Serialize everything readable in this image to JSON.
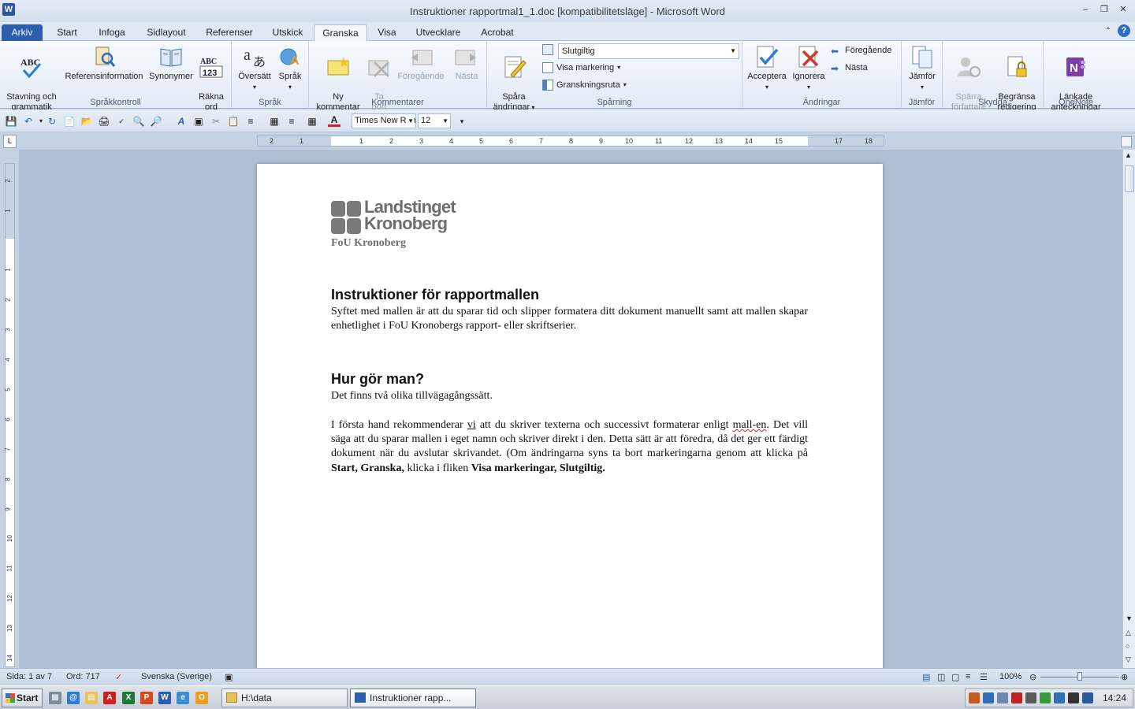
{
  "window": {
    "title": "Instruktioner rapportmal1_1.doc [kompatibilitetsläge]  -  Microsoft Word",
    "app_icon": "W"
  },
  "tabs": [
    {
      "label": "Arkiv"
    },
    {
      "label": "Start"
    },
    {
      "label": "Infoga"
    },
    {
      "label": "Sidlayout"
    },
    {
      "label": "Referenser"
    },
    {
      "label": "Utskick"
    },
    {
      "label": "Granska"
    },
    {
      "label": "Visa"
    },
    {
      "label": "Utvecklare"
    },
    {
      "label": "Acrobat"
    }
  ],
  "ribbon": {
    "sprakkontroll": {
      "label": "Språkkontroll",
      "stavning": "Stavning och\ngrammatik",
      "referens": "Referensinformation",
      "synonymer": "Synonymer",
      "rakna": "Räkna\nord"
    },
    "sprak": {
      "label": "Språk",
      "oversatt": "Översätt",
      "sprak_btn": "Språk"
    },
    "kommentarer": {
      "label": "Kommentarer",
      "ny": "Ny\nkommentar",
      "tabort": "Ta\nbort",
      "foregaende": "Föregående",
      "nasta": "Nästa"
    },
    "sparning": {
      "label": "Spårning",
      "spara": "Spåra\nändringar",
      "combo_value": "Slutgiltig",
      "visa_markering": "Visa markering",
      "granskningsruta": "Granskningsruta"
    },
    "andringar": {
      "label": "Ändringar",
      "acceptera": "Acceptera",
      "ignorera": "Ignorera",
      "foregaende": "Föregående",
      "nasta": "Nästa"
    },
    "jamfor": {
      "label": "Jämför",
      "jamfor_btn": "Jämför"
    },
    "skydda": {
      "label": "Skydda",
      "sparra": "Spärra\nförfattare",
      "begransa": "Begränsa\nredigering"
    },
    "onenote": {
      "label": "OneNote",
      "lankade": "Länkade\nanteckningar"
    }
  },
  "qat": {
    "font": "Times New Roman",
    "size": "12"
  },
  "ruler": {
    "h_numbers": [
      "2",
      "1",
      "1",
      "2",
      "3",
      "4",
      "5",
      "6",
      "7",
      "8",
      "9",
      "10",
      "11",
      "12",
      "13",
      "14",
      "15",
      "17",
      "18"
    ],
    "v_numbers": [
      "2",
      "1",
      "1",
      "2",
      "3",
      "4",
      "5",
      "6",
      "7",
      "8",
      "9",
      "10",
      "11",
      "12",
      "13",
      "14"
    ]
  },
  "document": {
    "logo_line1": "Landstinget",
    "logo_line2": "Kronoberg",
    "logo_sub": "FoU Kronoberg",
    "heading1": "Instruktioner för rapportmallen",
    "para1": "Syftet med mallen är att du sparar tid och slipper formatera ditt dokument manuellt samt att mallen skapar enhetlighet i FoU Kronobergs rapport- eller skriftserier.",
    "heading2": "Hur gör man?",
    "para2": "Det finns två olika tillvägagångssätt.",
    "para3": {
      "t1": "I första hand rekommenderar ",
      "vi": "vi",
      "t2": " att du skriver texterna och successivt formaterar enligt ",
      "mallen": "mall-en",
      "t3": ". Det vill säga att du sparar mallen i eget namn och skriver direkt i den. Detta sätt är att föredra, då det ger ett färdigt dokument när du avslutar skrivandet. (Om ändringarna syns ta bort markeringarna genom att klicka på ",
      "b1": "Start, Granska,",
      "t4": " klicka i fliken ",
      "b2": "Visa markeringar, Slutgiltig."
    }
  },
  "status": {
    "page": "Sida: 1 av 7",
    "words": "Ord: 717",
    "language": "Svenska (Sverige)",
    "zoom": "100%"
  },
  "taskbar": {
    "start": "Start",
    "task1": "H:\\data",
    "task2": "Instruktioner rapp...",
    "clock": "14:24"
  },
  "colors": {
    "file_tab": "#2b5fad",
    "accent": "#2b579a"
  }
}
